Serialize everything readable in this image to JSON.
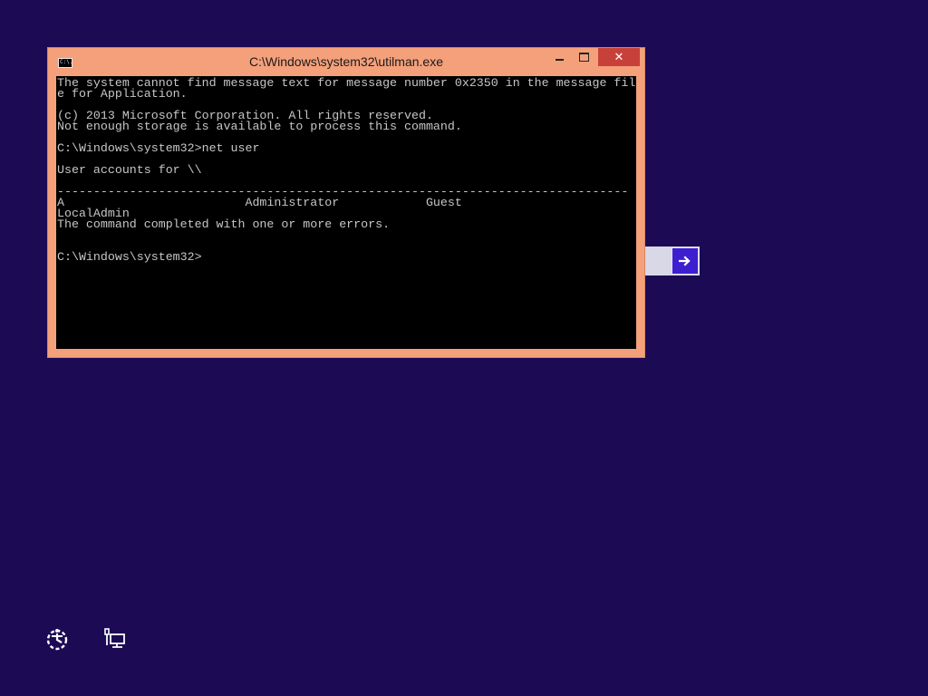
{
  "window": {
    "title": "C:\\Windows\\system32\\utilman.exe",
    "icon_label": "C:\\.",
    "minimize_icon": "minimize-icon",
    "maximize_icon": "maximize-icon",
    "close_glyph": "✕"
  },
  "console": {
    "lines": [
      "The system cannot find message text for message number 0x2350 in the message fil",
      "e for Application.",
      "",
      "(c) 2013 Microsoft Corporation. All rights reserved.",
      "Not enough storage is available to process this command.",
      "",
      "C:\\Windows\\system32>net user",
      "",
      "User accounts for \\\\",
      "",
      "-------------------------------------------------------------------------------",
      "A                         Administrator            Guest",
      "LocalAdmin",
      "The command completed with one or more errors.",
      "",
      "",
      "C:\\Windows\\system32>"
    ]
  },
  "submit": {
    "icon": "arrow-right-icon"
  },
  "corner_icons": {
    "ease_of_access": "ease-of-access-icon",
    "network": "network-icon"
  },
  "colors": {
    "background": "#1c0a55",
    "window_frame": "#f4a07a",
    "close_button": "#c7413a",
    "console_bg": "#000000",
    "console_text": "#c6c6c6",
    "arrow_button": "#3d1fd0"
  }
}
